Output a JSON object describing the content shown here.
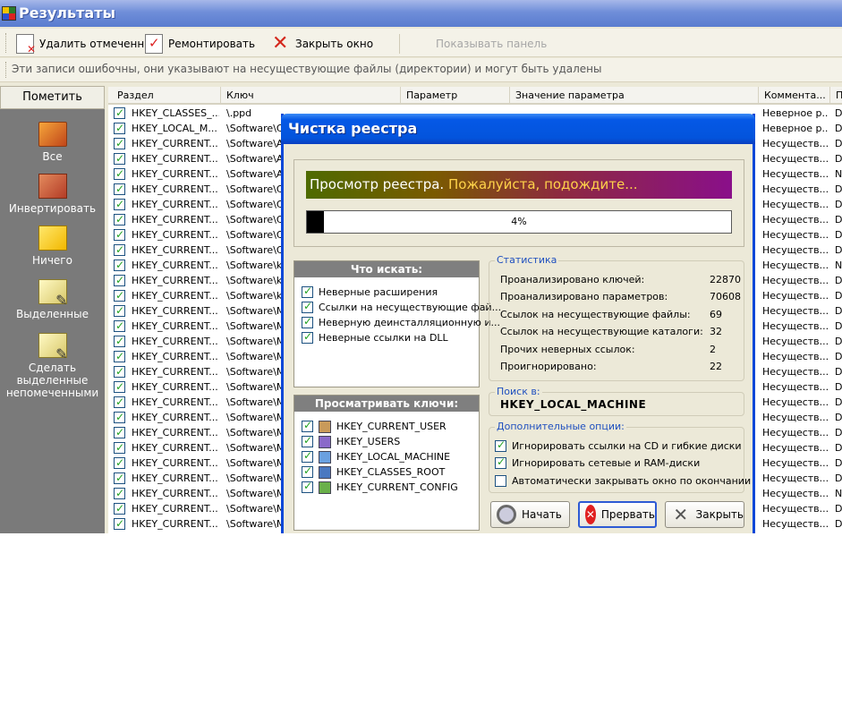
{
  "window": {
    "title": "Результаты"
  },
  "toolbar": {
    "delete_label": "Удалить отмеченные",
    "repair_label": "Ремонтировать",
    "close_label": "Закрыть окно",
    "panel_label": "Показывать панель"
  },
  "info_text": "Эти записи ошибочны, они указывают на несуществующие файлы (директории) и могут быть удалены",
  "left_panel": {
    "header": "Пометить",
    "items": [
      "Все",
      "Инвертировать",
      "Ничего",
      "Выделенные",
      "Сделать выделенные непомеченными"
    ]
  },
  "table": {
    "columns": [
      "Раздел",
      "Ключ",
      "Параметр",
      "Значение параметра",
      "Коммента...",
      "П"
    ],
    "rows": [
      {
        "section": "HKEY_CLASSES_...",
        "key": "\\.ppd",
        "comment": "Неверное р...",
        "last": "D"
      },
      {
        "section": "HKEY_LOCAL_M...",
        "key": "\\Software\\C",
        "comment": "Неверное р...",
        "last": "D"
      },
      {
        "section": "HKEY_CURRENT...",
        "key": "\\Software\\A",
        "comment": "Несуществ...",
        "last": "D"
      },
      {
        "section": "HKEY_CURRENT...",
        "key": "\\Software\\A",
        "comment": "Несуществ...",
        "last": "D"
      },
      {
        "section": "HKEY_CURRENT...",
        "key": "\\Software\\A",
        "comment": "Несуществ...",
        "last": "N"
      },
      {
        "section": "HKEY_CURRENT...",
        "key": "\\Software\\C",
        "comment": "Несуществ...",
        "last": "D"
      },
      {
        "section": "HKEY_CURRENT...",
        "key": "\\Software\\C",
        "comment": "Несуществ...",
        "last": "D"
      },
      {
        "section": "HKEY_CURRENT...",
        "key": "\\Software\\C",
        "comment": "Несуществ...",
        "last": "D"
      },
      {
        "section": "HKEY_CURRENT...",
        "key": "\\Software\\C",
        "comment": "Несуществ...",
        "last": "D"
      },
      {
        "section": "HKEY_CURRENT...",
        "key": "\\Software\\C",
        "comment": "Несуществ...",
        "last": "D"
      },
      {
        "section": "HKEY_CURRENT...",
        "key": "\\Software\\kl",
        "comment": "Несуществ...",
        "last": "N"
      },
      {
        "section": "HKEY_CURRENT...",
        "key": "\\Software\\kl",
        "comment": "Несуществ...",
        "last": "D"
      },
      {
        "section": "HKEY_CURRENT...",
        "key": "\\Software\\kl",
        "comment": "Несуществ...",
        "last": "D"
      },
      {
        "section": "HKEY_CURRENT...",
        "key": "\\Software\\M",
        "comment": "Несуществ...",
        "last": "D"
      },
      {
        "section": "HKEY_CURRENT...",
        "key": "\\Software\\M",
        "comment": "Несуществ...",
        "last": "D"
      },
      {
        "section": "HKEY_CURRENT...",
        "key": "\\Software\\M",
        "comment": "Несуществ...",
        "last": "D"
      },
      {
        "section": "HKEY_CURRENT...",
        "key": "\\Software\\M",
        "comment": "Несуществ...",
        "last": "D"
      },
      {
        "section": "HKEY_CURRENT...",
        "key": "\\Software\\M",
        "comment": "Несуществ...",
        "last": "D"
      },
      {
        "section": "HKEY_CURRENT...",
        "key": "\\Software\\M",
        "comment": "Несуществ...",
        "last": "D"
      },
      {
        "section": "HKEY_CURRENT...",
        "key": "\\Software\\M",
        "comment": "Несуществ...",
        "last": "D"
      },
      {
        "section": "HKEY_CURRENT...",
        "key": "\\Software\\M",
        "comment": "Несуществ...",
        "last": "D"
      },
      {
        "section": "HKEY_CURRENT...",
        "key": "\\Software\\M",
        "comment": "Несуществ...",
        "last": "D"
      },
      {
        "section": "HKEY_CURRENT...",
        "key": "\\Software\\M",
        "comment": "Несуществ...",
        "last": "D"
      },
      {
        "section": "HKEY_CURRENT...",
        "key": "\\Software\\M",
        "comment": "Несуществ...",
        "last": "D"
      },
      {
        "section": "HKEY_CURRENT...",
        "key": "\\Software\\M",
        "comment": "Несуществ...",
        "last": "D"
      },
      {
        "section": "HKEY_CURRENT...",
        "key": "\\Software\\M",
        "comment": "Несуществ...",
        "last": "N"
      },
      {
        "section": "HKEY_CURRENT...",
        "key": "\\Software\\M",
        "comment": "Несуществ...",
        "last": "D"
      },
      {
        "section": "HKEY_CURRENT...",
        "key": "\\Software\\M",
        "comment": "Несуществ...",
        "last": "D"
      },
      {
        "section": "HKEY_CURRENT...",
        "key": "\\Software\\M",
        "comment": "Несуществ...",
        "last": "D"
      }
    ]
  },
  "dialog": {
    "title": "Чистка реестра",
    "banner_text": "Просмотр реестра.",
    "banner_wait": "Пожалуйста, подождите...",
    "progress_percent": 4,
    "progress_label": "4%",
    "search_for": {
      "header": "Что искать:",
      "items": [
        "Неверные расширения",
        "Ссылки на несуществующие фай...",
        "Неверную деинсталляционную и...",
        "Неверные ссылки на DLL"
      ]
    },
    "browse_keys": {
      "header": "Просматривать ключи:",
      "items": [
        "HKEY_CURRENT_USER",
        "HKEY_USERS",
        "HKEY_LOCAL_MACHINE",
        "HKEY_CLASSES_ROOT",
        "HKEY_CURRENT_CONFIG"
      ]
    },
    "stats": {
      "legend": "Статистика",
      "rows": [
        {
          "label": "Проанализировано ключей:",
          "value": "22870"
        },
        {
          "label": "Проанализировано параметров:",
          "value": "70608"
        },
        {
          "label": "Ссылок на несуществующие файлы:",
          "value": "69"
        },
        {
          "label": "Ссылок на несуществующие каталоги:",
          "value": "32"
        },
        {
          "label": "Прочих неверных ссылок:",
          "value": "2"
        },
        {
          "label": "Проигнорировано:",
          "value": "22"
        }
      ]
    },
    "search_in": {
      "legend": "Поиск в:",
      "value": "HKEY_LOCAL_MACHINE"
    },
    "options": {
      "legend": "Дополнительные опции:",
      "items": [
        {
          "label": "Игнорировать ссылки на CD и гибкие диски",
          "checked": true
        },
        {
          "label": "Игнорировать сетевые и RAM-диски",
          "checked": true
        },
        {
          "label": "Автоматически закрывать окно по окончании",
          "checked": false
        }
      ]
    },
    "buttons": {
      "start": "Начать",
      "abort": "Прервать",
      "close": "Закрыть"
    }
  }
}
